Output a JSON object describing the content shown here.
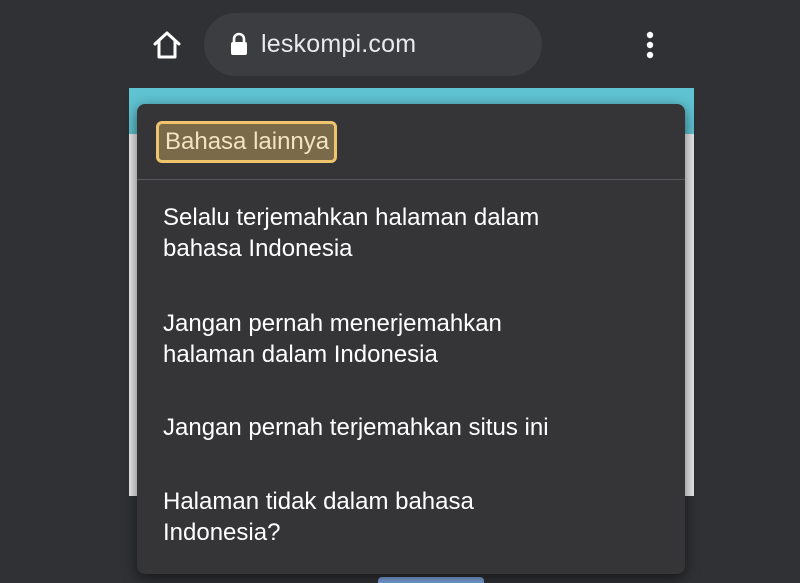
{
  "toolbar": {
    "url": "leskompi.com",
    "home_icon": "home-icon",
    "lock_icon": "lock-icon",
    "menu_icon": "more-vert-icon"
  },
  "translate_menu": {
    "more_languages": "Bahasa lainnya",
    "items": [
      {
        "line1": "Selalu terjemahkan halaman dalam",
        "line2": "bahasa Indonesia"
      },
      {
        "line1": "Jangan pernah menerjemahkan",
        "line2": "halaman dalam Indonesia"
      },
      {
        "line1": "Jangan pernah terjemahkan situs ini",
        "line2": ""
      },
      {
        "line1": "Halaman tidak dalam bahasa",
        "line2": "Indonesia?"
      }
    ]
  },
  "colors": {
    "background": "#303134",
    "popup": "#353538",
    "highlight_border": "#f0c36d",
    "page_accent": "#5fc3d2"
  }
}
